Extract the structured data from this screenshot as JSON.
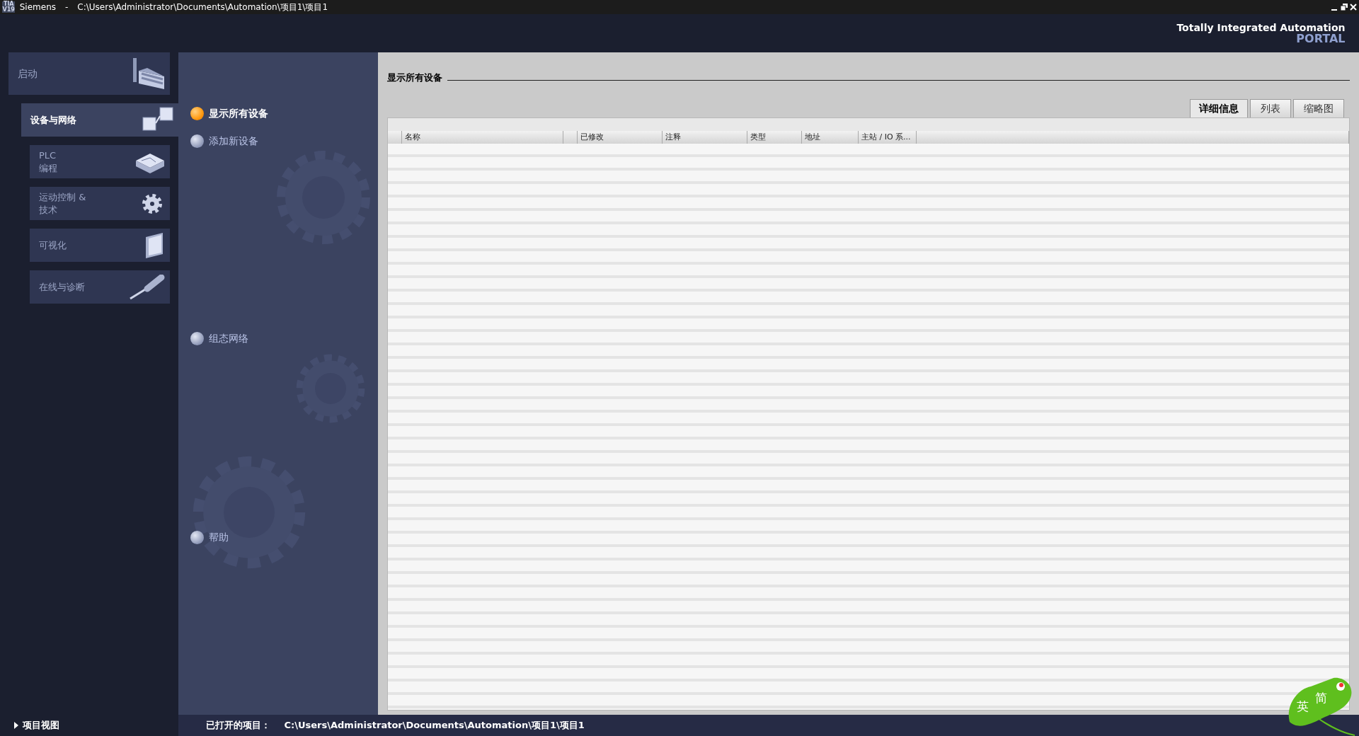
{
  "window": {
    "logo": [
      "TIA",
      "V19"
    ],
    "app": "Siemens",
    "separator": "-",
    "path": "C:\\Users\\Administrator\\Documents\\Automation\\项目1\\项目1"
  },
  "brand": {
    "line1": "Totally Integrated Automation",
    "line2": "PORTAL"
  },
  "portal_nav": [
    {
      "label": "启动",
      "kind": "top",
      "selected": false
    },
    {
      "label": "设备与网络",
      "kind": "sub",
      "selected": true
    },
    {
      "label": "PLC\n编程",
      "kind": "sub",
      "selected": false
    },
    {
      "label": "运动控制 &\n技术",
      "kind": "sub",
      "selected": false
    },
    {
      "label": "可视化",
      "kind": "sub",
      "selected": false
    },
    {
      "label": "在线与诊断",
      "kind": "sub",
      "selected": false
    }
  ],
  "actions": [
    {
      "label": "显示所有设备",
      "selected": true
    },
    {
      "label": "添加新设备",
      "selected": false
    },
    {
      "label": "组态网络",
      "selected": false
    },
    {
      "label": "帮助",
      "selected": false
    }
  ],
  "content": {
    "title": "显示所有设备",
    "view_tabs": [
      {
        "label": "详细信息",
        "selected": true
      },
      {
        "label": "列表",
        "selected": false
      },
      {
        "label": "缩略图",
        "selected": false
      }
    ],
    "table": {
      "columns": [
        "名称",
        "已修改",
        "注释",
        "类型",
        "地址",
        "主站 / IO 系..."
      ]
    }
  },
  "status_bar": {
    "project_view": "项目视图",
    "opened_label": "已打开的项目：",
    "opened_path": "C:\\Users\\Administrator\\Documents\\Automation\\项目1\\项目1"
  },
  "ime": {
    "language": "英",
    "mode": "简"
  }
}
